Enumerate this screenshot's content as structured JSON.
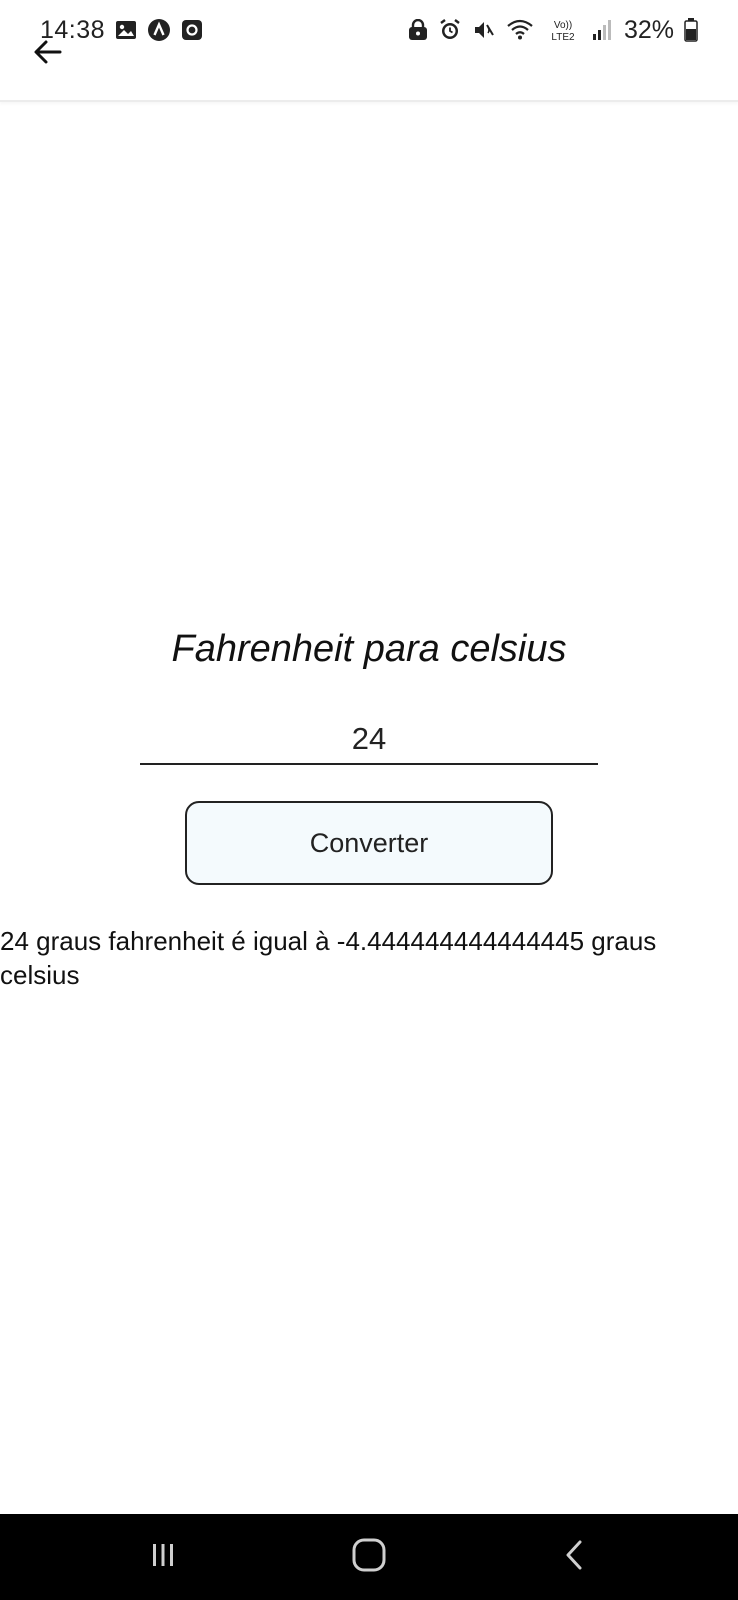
{
  "status_bar": {
    "time": "14:38",
    "battery_percent": "32%",
    "left_icons": [
      "gallery-icon",
      "a-badge-icon",
      "record-icon"
    ],
    "right_icons": [
      "lock-icon",
      "alarm-icon",
      "mute-icon",
      "wifi-icon",
      "volte-icon",
      "signal-icon",
      "battery-icon"
    ]
  },
  "header": {
    "back_icon": "arrow-left-icon"
  },
  "main": {
    "title": "Fahrenheit para celsius",
    "input_value": "24",
    "convert_label": "Converter",
    "result": "24 graus fahrenheit é igual à -4.444444444444445 graus celsius"
  },
  "nav_bar": {
    "buttons": [
      "recent-apps-icon",
      "home-icon",
      "back-icon"
    ]
  }
}
